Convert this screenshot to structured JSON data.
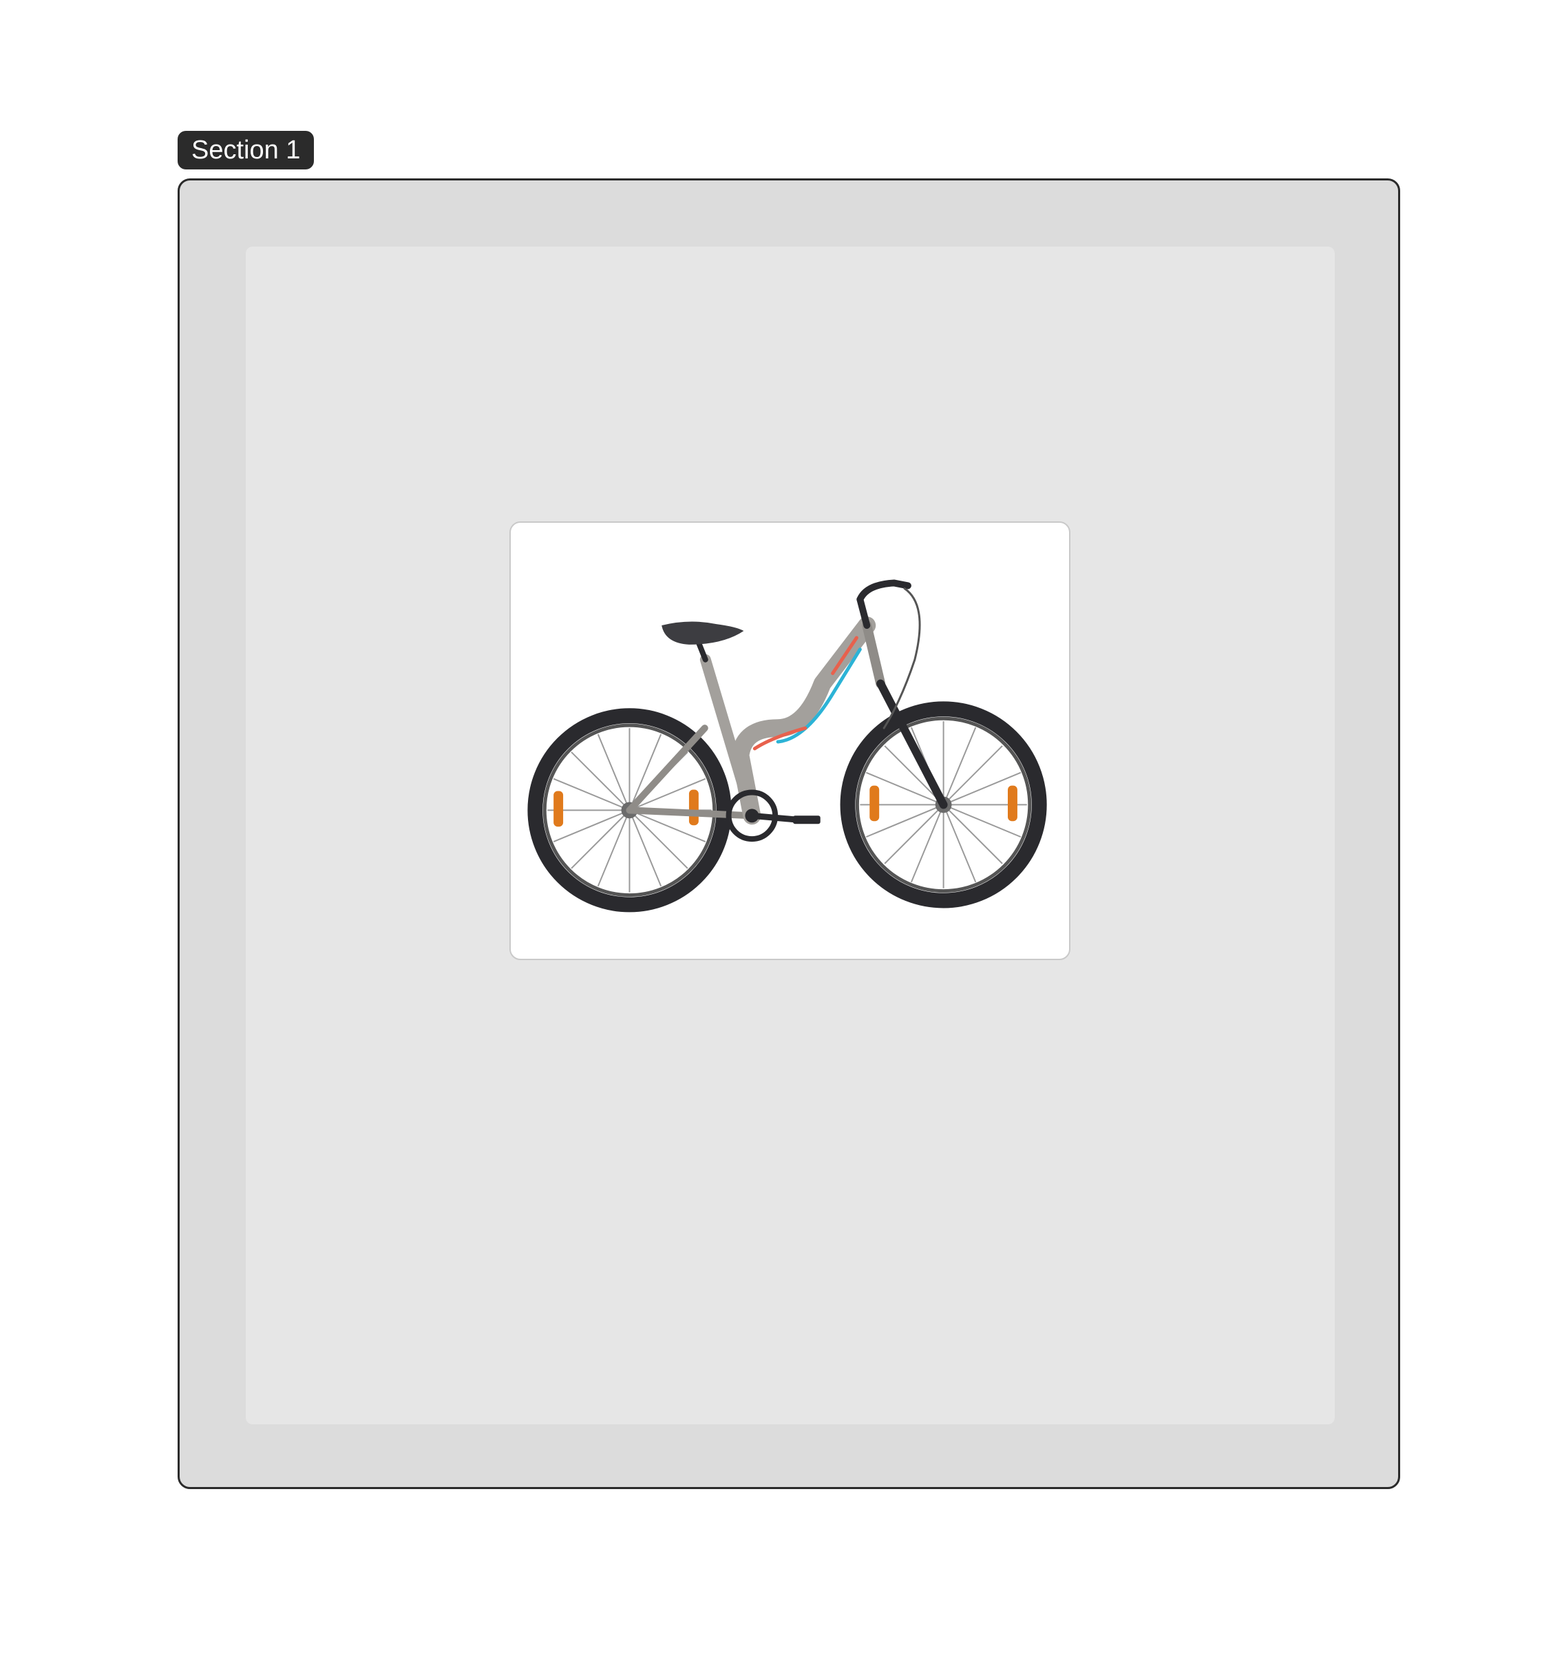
{
  "section": {
    "label": "Section 1"
  },
  "product_image": {
    "subject": "bicycle-icon",
    "colors": {
      "frame": "#a3a09c",
      "accent_red": "#e8614d",
      "accent_blue": "#2cb3d6",
      "tyre": "#2a2a2e",
      "reflector": "#e07a1c"
    }
  }
}
